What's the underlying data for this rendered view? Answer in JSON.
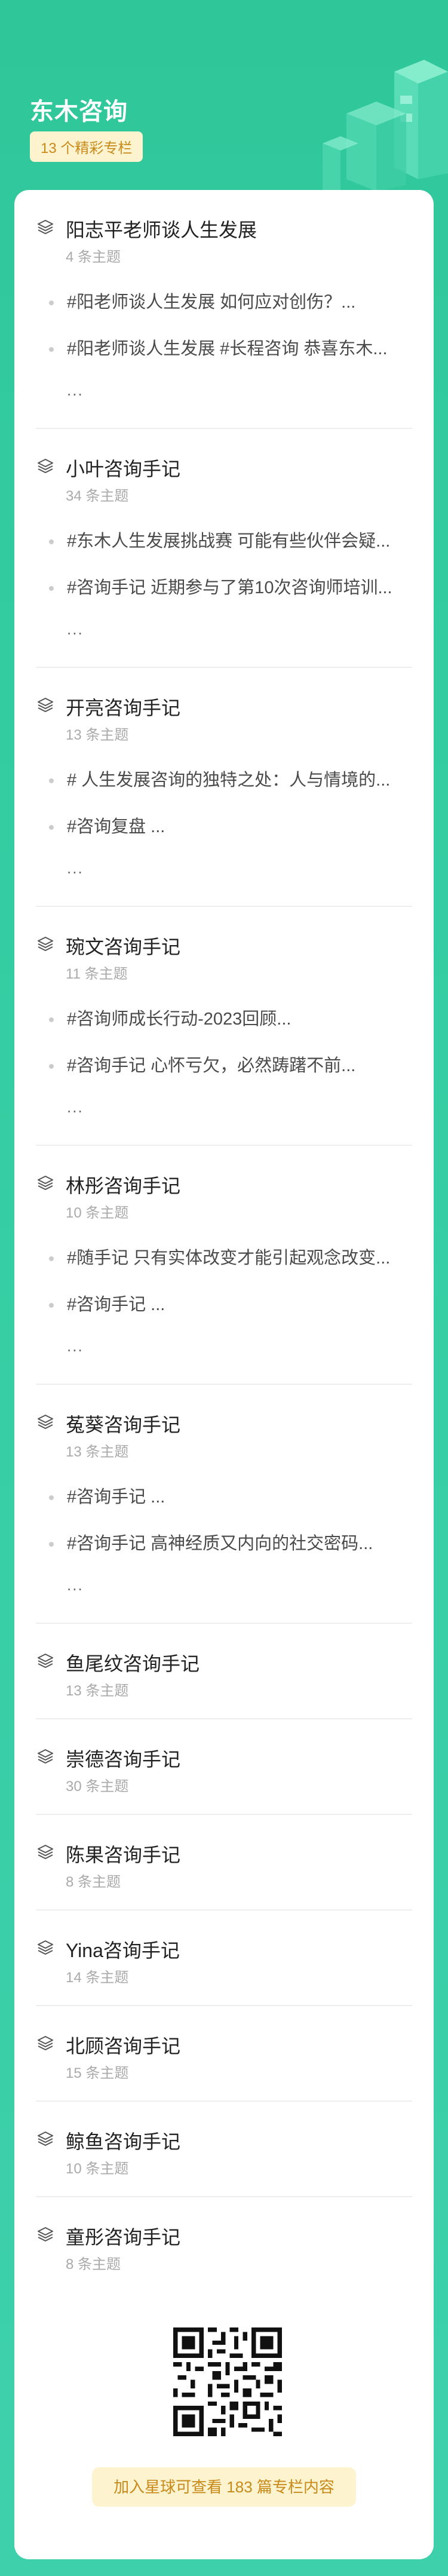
{
  "header": {
    "title": "东木咨询",
    "badge": "13 个精彩专栏"
  },
  "columns": [
    {
      "title": "阳志平老师谈人生发展",
      "count": "4 条主题",
      "topics": [
        "#阳老师谈人生发展 如何应对创伤？...",
        "#阳老师谈人生发展 #长程咨询  恭喜东木..."
      ],
      "more": "..."
    },
    {
      "title": "小叶咨询手记",
      "count": "34 条主题",
      "topics": [
        "#东木人生发展挑战赛 可能有些伙伴会疑...",
        "#咨询手记 近期参与了第10次咨询师培训..."
      ],
      "more": "..."
    },
    {
      "title": "开亮咨询手记",
      "count": "13 条主题",
      "topics": [
        "# 人生发展咨询的独特之处：人与情境的...",
        "#咨询复盘 ..."
      ],
      "more": "..."
    },
    {
      "title": "琬文咨询手记",
      "count": "11 条主题",
      "topics": [
        "#咨询师成长行动-2023回顾...",
        "#咨询手记 心怀亏欠，必然踌躇不前..."
      ],
      "more": "..."
    },
    {
      "title": "林彤咨询手记",
      "count": "10 条主题",
      "topics": [
        "#随手记 只有实体改变才能引起观念改变...",
        "#咨询手记 ..."
      ],
      "more": "..."
    },
    {
      "title": "菟葵咨询手记",
      "count": "13 条主题",
      "topics": [
        "#咨询手记 ...",
        "#咨询手记   高神经质又内向的社交密码..."
      ],
      "more": "..."
    },
    {
      "title": "鱼尾纹咨询手记",
      "count": "13 条主题",
      "topics": [],
      "more": ""
    },
    {
      "title": "崇德咨询手记",
      "count": "30 条主题",
      "topics": [],
      "more": ""
    },
    {
      "title": "陈果咨询手记",
      "count": "8 条主题",
      "topics": [],
      "more": ""
    },
    {
      "title": "Yina咨询手记",
      "count": "14 条主题",
      "topics": [],
      "more": ""
    },
    {
      "title": "北顾咨询手记",
      "count": "15 条主题",
      "topics": [],
      "more": ""
    },
    {
      "title": "鲸鱼咨询手记",
      "count": "10 条主题",
      "topics": [],
      "more": ""
    },
    {
      "title": "童彤咨询手记",
      "count": "8 条主题",
      "topics": [],
      "more": ""
    }
  ],
  "footer": {
    "cta": "加入星球可查看 183 篇专栏内容"
  },
  "icons": {
    "column": "layers-icon",
    "qr": "qr-code-icon"
  },
  "colors": {
    "background": "#35cda3",
    "badge_bg": "#fdf3cf",
    "badge_text": "#c88a1a"
  }
}
